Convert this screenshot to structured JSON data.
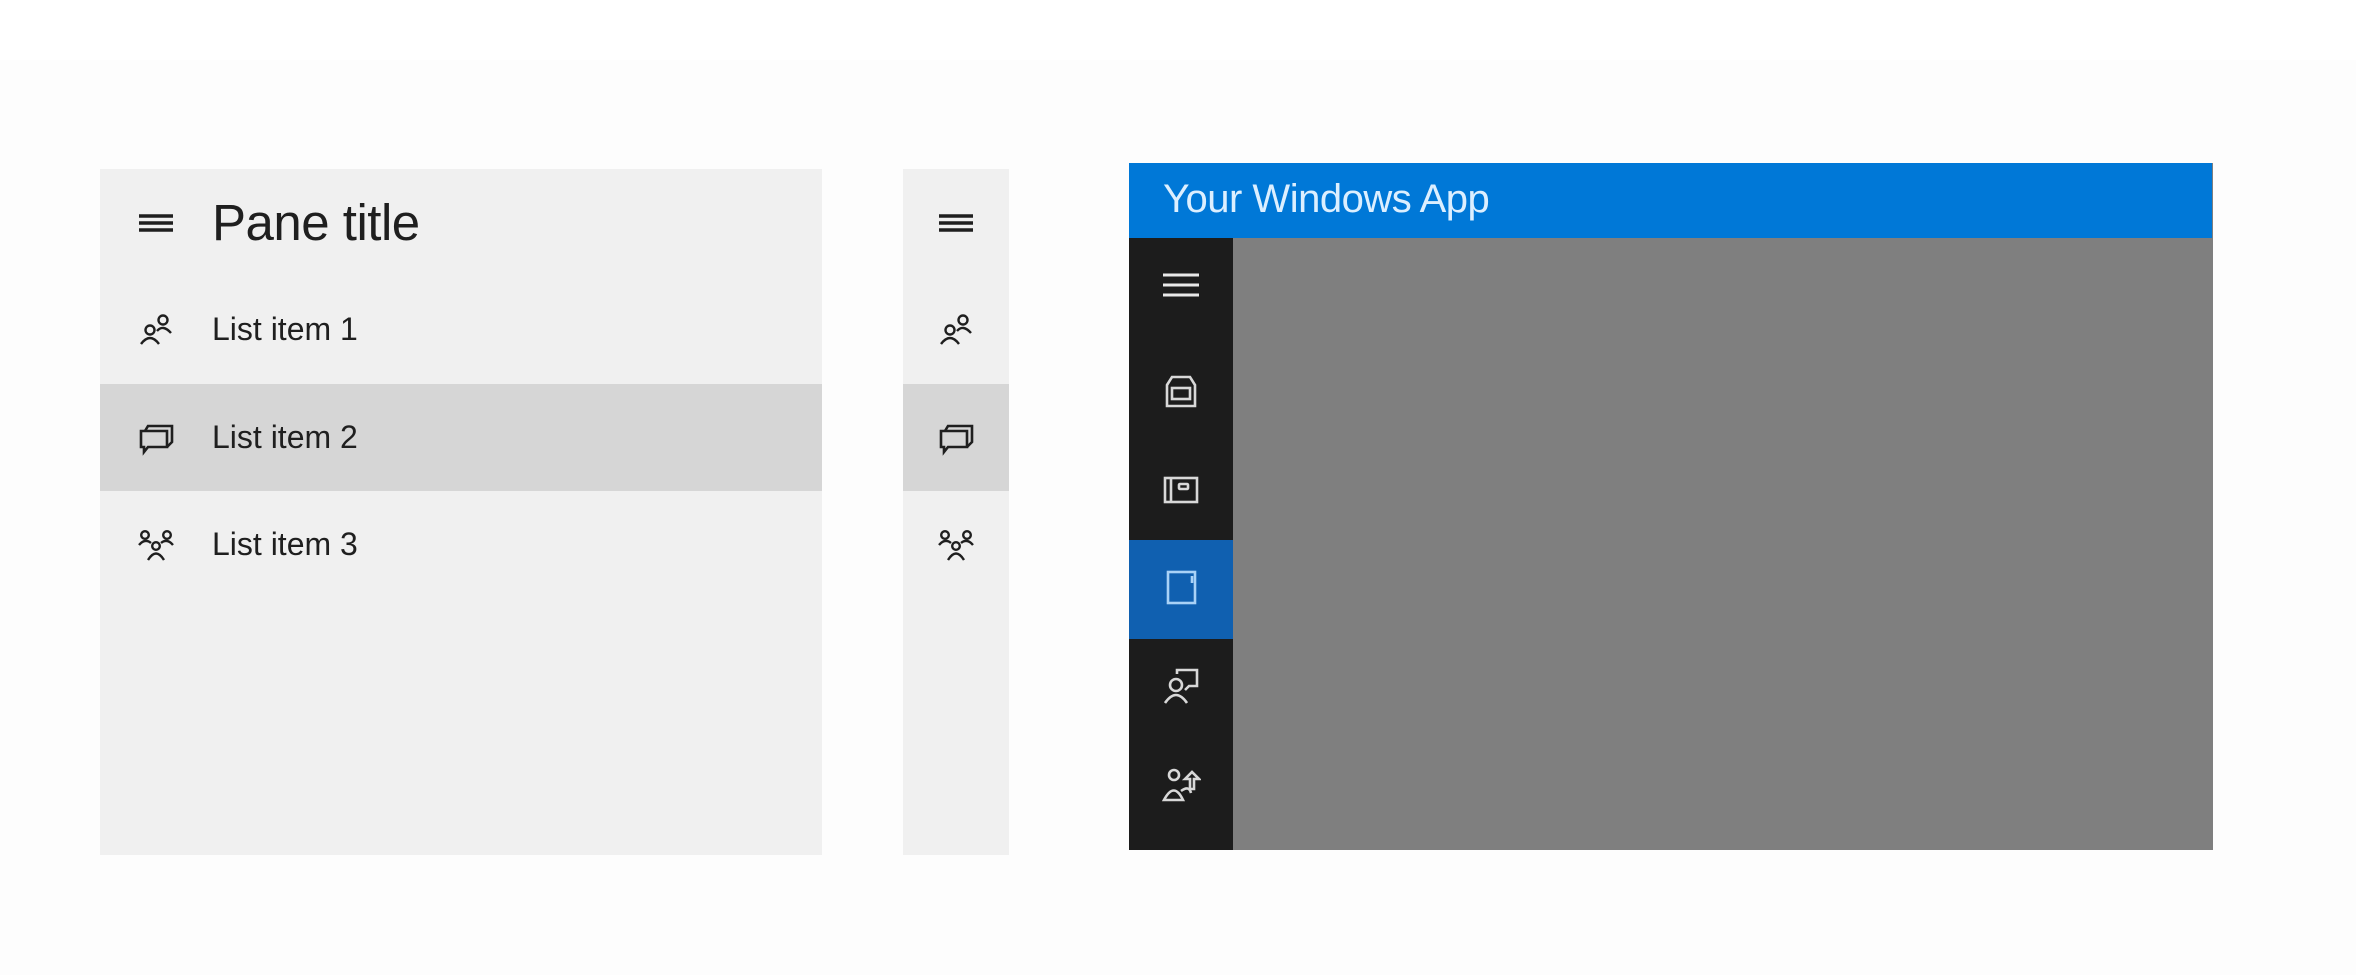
{
  "expanded_pane": {
    "menu_icon": "hamburger-icon",
    "title": "Pane title",
    "items": [
      {
        "label": "List item 1",
        "icon": "contacts-icon",
        "selected": false
      },
      {
        "label": "List item 2",
        "icon": "chat-icon",
        "selected": true
      },
      {
        "label": "List item 3",
        "icon": "group-icon",
        "selected": false
      }
    ]
  },
  "compact_pane": {
    "menu_icon": "hamburger-icon",
    "items": [
      {
        "icon": "contacts-icon",
        "selected": false
      },
      {
        "icon": "chat-icon",
        "selected": true
      },
      {
        "icon": "group-icon",
        "selected": false
      }
    ]
  },
  "app": {
    "title": "Your Windows App",
    "accent_color": "#0078d7",
    "nav_background": "#1c1c1c",
    "selected_color": "#1060b0",
    "content_color": "#7f7f7f",
    "nav_items": [
      {
        "icon": "hamburger-icon",
        "selected": false
      },
      {
        "icon": "network-port-icon",
        "selected": false
      },
      {
        "icon": "card-reader-icon",
        "selected": false
      },
      {
        "icon": "tablet-icon",
        "selected": true
      },
      {
        "icon": "presenter-icon",
        "selected": false
      },
      {
        "icon": "user-share-icon",
        "selected": false
      }
    ]
  }
}
